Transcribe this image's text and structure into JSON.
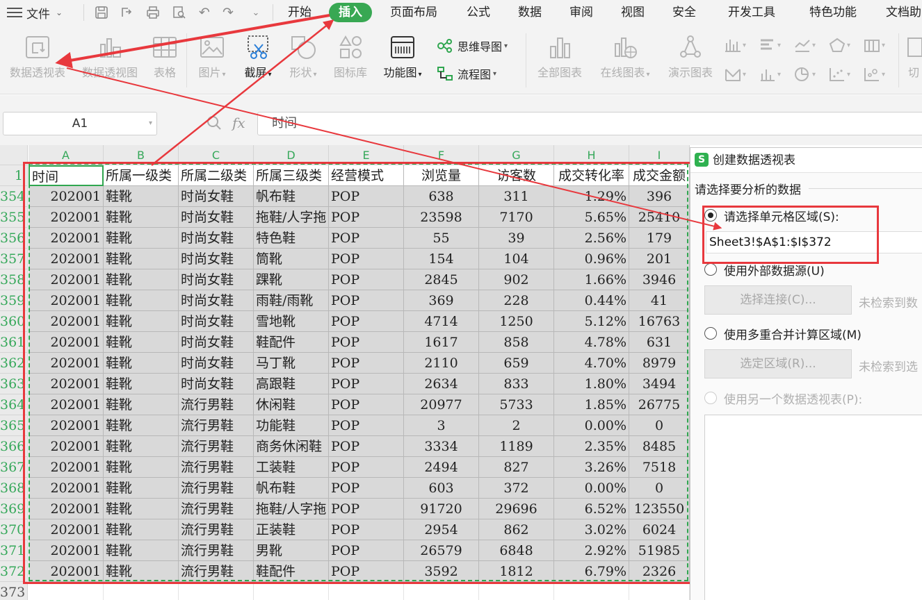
{
  "menu": {
    "file_label": "文件",
    "tabs": [
      "开始",
      "插入",
      "页面布局",
      "公式",
      "数据",
      "审阅",
      "视图",
      "安全",
      "开发工具",
      "特色功能",
      "文档助"
    ]
  },
  "ribbon": {
    "pivot_table": "数据透视表",
    "pivot_chart": "数据透视图",
    "table": "表格",
    "picture": "图片",
    "screenshot": "截屏",
    "shape": "形状",
    "icon_library": "图标库",
    "function_chart": "功能图",
    "mind_map": "思维导图",
    "flowchart": "流程图",
    "all_charts": "全部图表",
    "online_charts": "在线图表",
    "demo_charts": "演示图表",
    "cut": "切"
  },
  "formula_bar": {
    "name_box": "A1",
    "fx": "fx",
    "formula": "时间"
  },
  "sheet": {
    "columns": [
      "A",
      "B",
      "C",
      "D",
      "E",
      "F",
      "G",
      "H",
      "I"
    ],
    "header_row_number": "1",
    "header": [
      "时间",
      "所属一级类",
      "所属二级类",
      "所属三级类",
      "经营模式",
      "浏览量",
      "访客数",
      "成交转化率",
      "成交金额"
    ],
    "rows": [
      {
        "n": "354",
        "cells": [
          "202001",
          "鞋靴",
          "时尚女鞋",
          "帆布鞋",
          "POP",
          "638",
          "311",
          "1.29%",
          "396"
        ]
      },
      {
        "n": "355",
        "cells": [
          "202001",
          "鞋靴",
          "时尚女鞋",
          "拖鞋/人字拖",
          "POP",
          "23598",
          "7170",
          "5.65%",
          "25410"
        ]
      },
      {
        "n": "356",
        "cells": [
          "202001",
          "鞋靴",
          "时尚女鞋",
          "特色鞋",
          "POP",
          "55",
          "39",
          "2.56%",
          "179"
        ]
      },
      {
        "n": "357",
        "cells": [
          "202001",
          "鞋靴",
          "时尚女鞋",
          "筒靴",
          "POP",
          "154",
          "104",
          "0.96%",
          "201"
        ]
      },
      {
        "n": "358",
        "cells": [
          "202001",
          "鞋靴",
          "时尚女鞋",
          "踝靴",
          "POP",
          "2845",
          "902",
          "1.66%",
          "3946"
        ]
      },
      {
        "n": "359",
        "cells": [
          "202001",
          "鞋靴",
          "时尚女鞋",
          "雨鞋/雨靴",
          "POP",
          "369",
          "228",
          "0.44%",
          "41"
        ]
      },
      {
        "n": "360",
        "cells": [
          "202001",
          "鞋靴",
          "时尚女鞋",
          "雪地靴",
          "POP",
          "4714",
          "1250",
          "5.12%",
          "16763"
        ]
      },
      {
        "n": "361",
        "cells": [
          "202001",
          "鞋靴",
          "时尚女鞋",
          "鞋配件",
          "POP",
          "1617",
          "858",
          "4.78%",
          "631"
        ]
      },
      {
        "n": "362",
        "cells": [
          "202001",
          "鞋靴",
          "时尚女鞋",
          "马丁靴",
          "POP",
          "2110",
          "659",
          "4.70%",
          "8979"
        ]
      },
      {
        "n": "363",
        "cells": [
          "202001",
          "鞋靴",
          "时尚女鞋",
          "高跟鞋",
          "POP",
          "2634",
          "833",
          "1.80%",
          "3494"
        ]
      },
      {
        "n": "364",
        "cells": [
          "202001",
          "鞋靴",
          "流行男鞋",
          "休闲鞋",
          "POP",
          "20977",
          "5733",
          "1.85%",
          "26775"
        ]
      },
      {
        "n": "365",
        "cells": [
          "202001",
          "鞋靴",
          "流行男鞋",
          "功能鞋",
          "POP",
          "3",
          "2",
          "0.00%",
          "0"
        ]
      },
      {
        "n": "366",
        "cells": [
          "202001",
          "鞋靴",
          "流行男鞋",
          "商务休闲鞋",
          "POP",
          "3334",
          "1189",
          "2.35%",
          "8485"
        ]
      },
      {
        "n": "367",
        "cells": [
          "202001",
          "鞋靴",
          "流行男鞋",
          "工装鞋",
          "POP",
          "2494",
          "827",
          "3.26%",
          "7518"
        ]
      },
      {
        "n": "368",
        "cells": [
          "202001",
          "鞋靴",
          "流行男鞋",
          "帆布鞋",
          "POP",
          "603",
          "372",
          "0.00%",
          "0"
        ]
      },
      {
        "n": "369",
        "cells": [
          "202001",
          "鞋靴",
          "流行男鞋",
          "拖鞋/人字拖",
          "POP",
          "91720",
          "29696",
          "6.52%",
          "123550"
        ]
      },
      {
        "n": "370",
        "cells": [
          "202001",
          "鞋靴",
          "流行男鞋",
          "正装鞋",
          "POP",
          "2954",
          "862",
          "3.02%",
          "6024"
        ]
      },
      {
        "n": "371",
        "cells": [
          "202001",
          "鞋靴",
          "流行男鞋",
          "男靴",
          "POP",
          "26579",
          "6848",
          "2.92%",
          "51985"
        ]
      },
      {
        "n": "372",
        "cells": [
          "202001",
          "鞋靴",
          "流行男鞋",
          "鞋配件",
          "POP",
          "3592",
          "1812",
          "6.79%",
          "2326"
        ]
      }
    ],
    "last_row_number": "373"
  },
  "dialog": {
    "icon_letter": "S",
    "title": "创建数据透视表",
    "section_label": "请选择要分析的数据",
    "opt_range": "请选择单元格区域(S):",
    "range_value": "Sheet3!$A$1:$I$372",
    "opt_external": "使用外部数据源(U)",
    "btn_connection": "选择连接(C)...",
    "no_data_1": "未检索到数",
    "opt_consolidate": "使用多重合并计算区域(M)",
    "btn_select_region": "选定区域(R)...",
    "no_data_2": "未检索到选",
    "opt_other_pivot": "使用另一个数据透视表(P):"
  },
  "colors": {
    "accent_green": "#38a853",
    "annotation_red": "#e8383d"
  }
}
